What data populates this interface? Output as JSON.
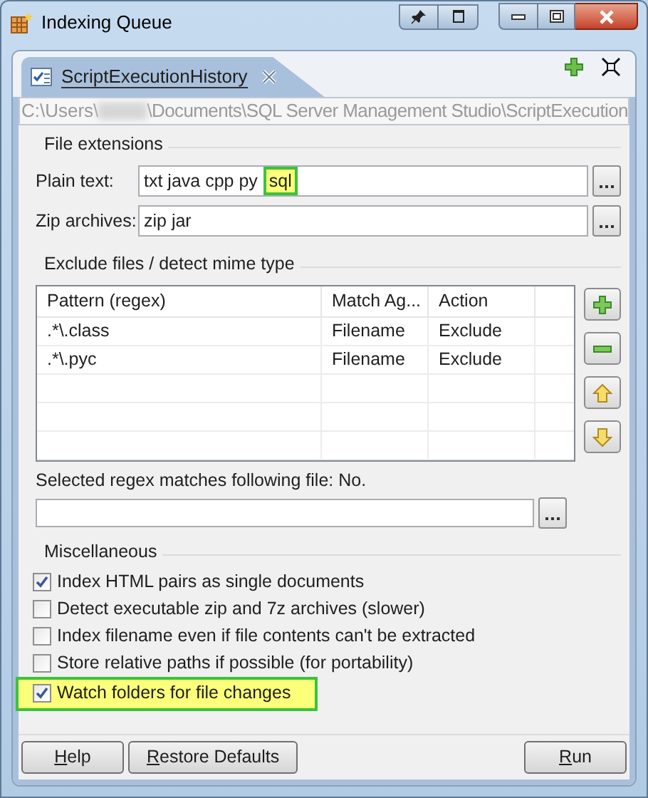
{
  "window": {
    "title": "Indexing Queue"
  },
  "tab": {
    "label": "ScriptExecutionHistory",
    "selected": true
  },
  "path": {
    "before_redacted": "C:\\Users\\",
    "after_redacted": "\\Documents\\SQL Server Management Studio\\ScriptExecution"
  },
  "file_extensions": {
    "title": "File extensions",
    "fields": [
      {
        "label": "Plain text:",
        "value": "txt java cpp py",
        "highlighted_value": "sql"
      },
      {
        "label": "Zip archives:",
        "value": "zip jar"
      }
    ]
  },
  "exclude": {
    "title": "Exclude files / detect mime type",
    "columns": [
      "Pattern (regex)",
      "Match Ag...",
      "Action"
    ],
    "rows": [
      [
        ".*\\.class",
        "Filename",
        "Exclude"
      ],
      [
        ".*\\.pyc",
        "Filename",
        "Exclude"
      ]
    ],
    "side_buttons": [
      {
        "kind": "add"
      },
      {
        "kind": "remove"
      },
      {
        "kind": "up"
      },
      {
        "kind": "down"
      }
    ],
    "match_label": "Selected regex matches following file: No."
  },
  "misc": {
    "title": "Miscellaneous",
    "options": [
      {
        "label": "Index HTML pairs as single documents",
        "checked": true,
        "highlighted": false
      },
      {
        "label": "Detect executable zip and 7z archives (slower)",
        "checked": false,
        "highlighted": false
      },
      {
        "label": "Index filename even if file contents can't be extracted",
        "checked": false,
        "highlighted": false
      },
      {
        "label": "Store relative paths if possible (for portability)",
        "checked": false,
        "highlighted": false
      },
      {
        "label": "Watch folders for file changes",
        "checked": true,
        "highlighted": true
      }
    ]
  },
  "buttons": [
    {
      "label": "Help",
      "mnemonic": true
    },
    {
      "label": "Restore Defaults",
      "mnemonic": true
    },
    {
      "label": "Run",
      "mnemonic": true
    }
  ]
}
